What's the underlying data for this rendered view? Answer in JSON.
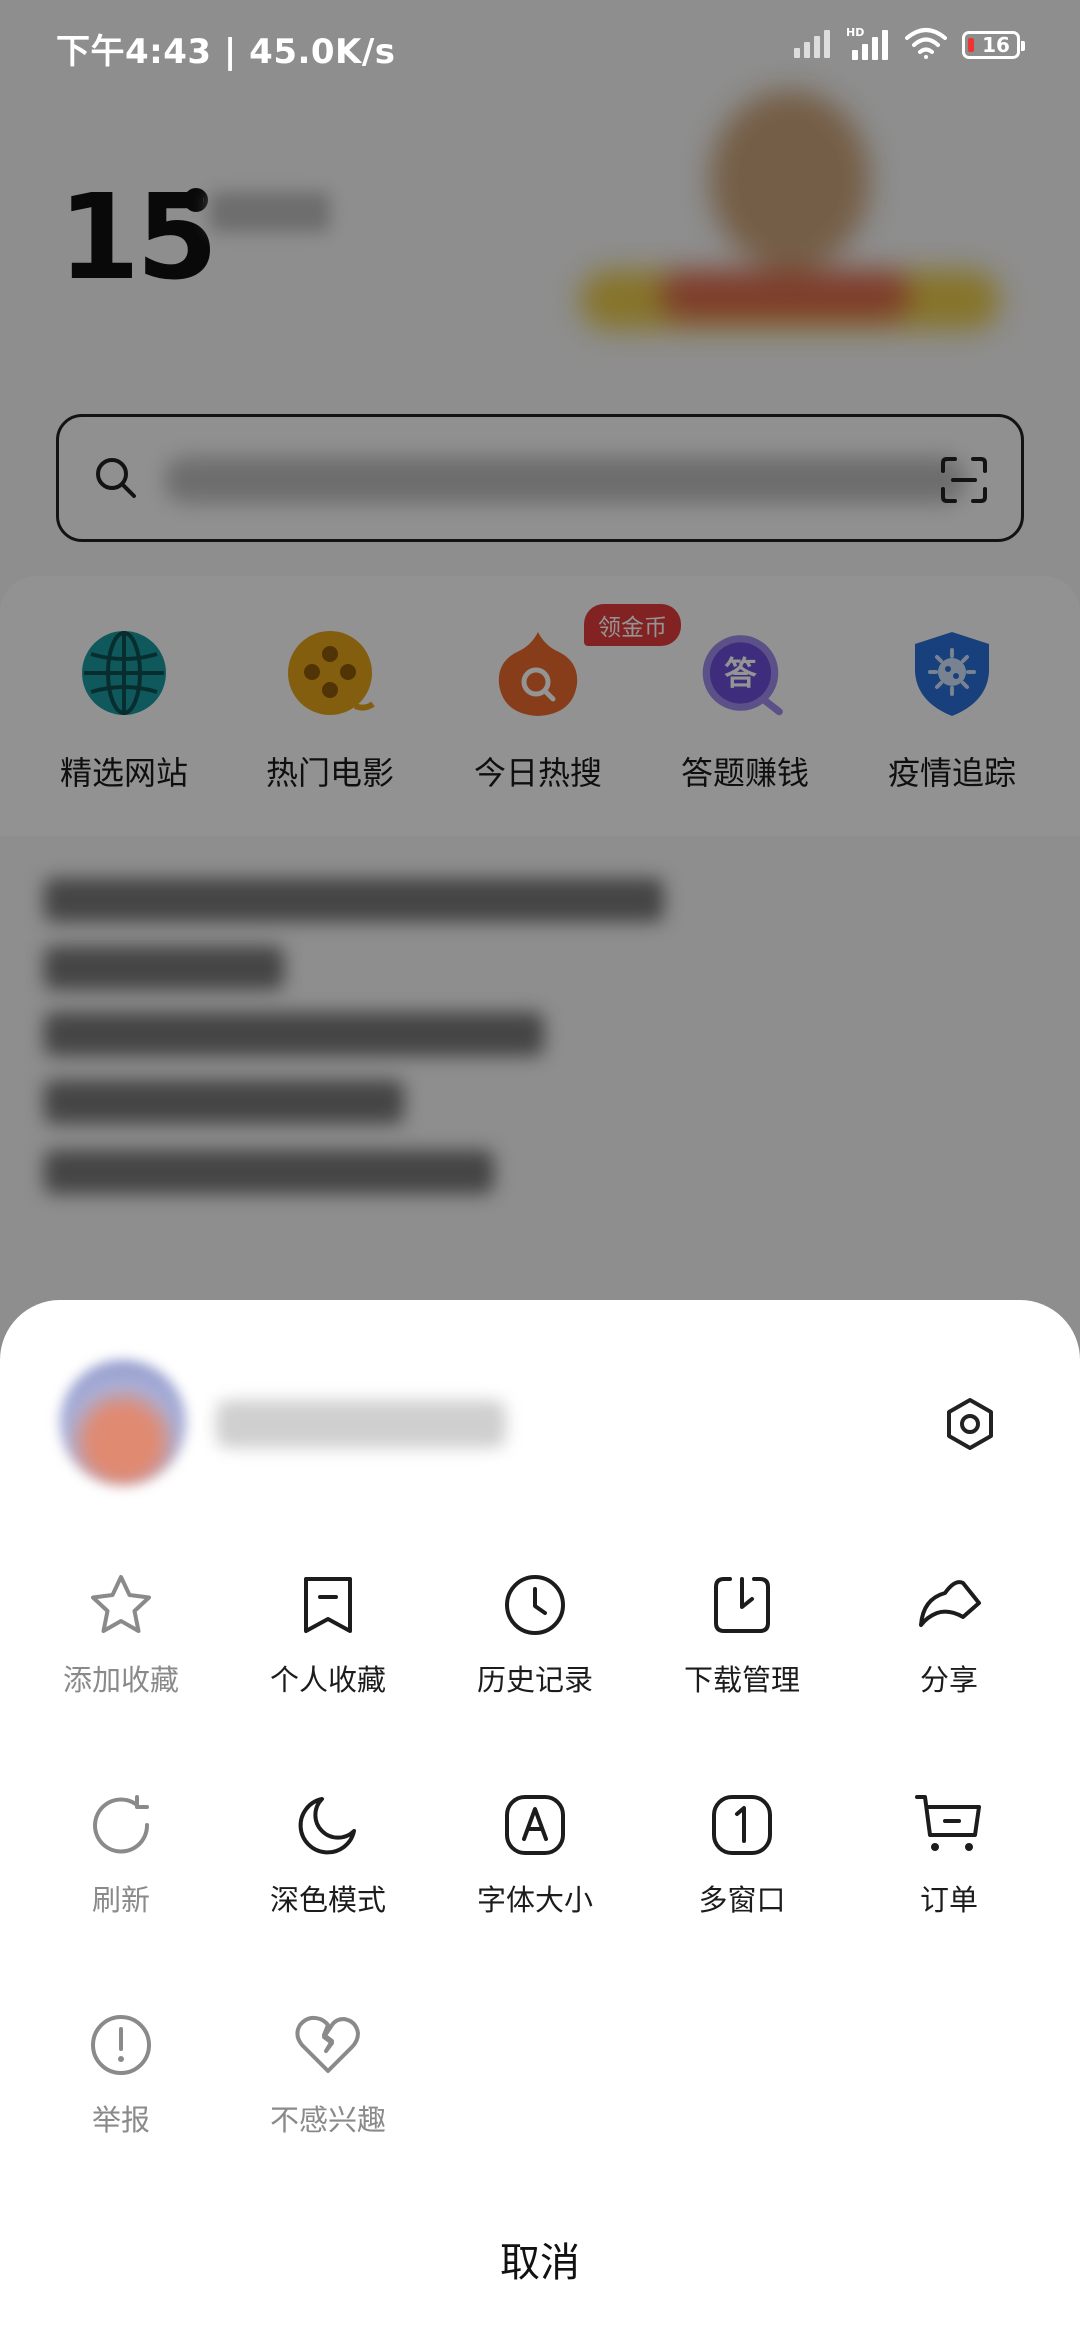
{
  "status_bar": {
    "time_speed": "下午4:43 | 45.0K/s",
    "battery": "16"
  },
  "weather": {
    "temperature": "15"
  },
  "quick_links": [
    {
      "label": "精选网站",
      "icon": "globe-icon",
      "color": "#1a9aa0"
    },
    {
      "label": "热门电影",
      "icon": "film-reel-icon",
      "color": "#e3a21a"
    },
    {
      "label": "今日热搜",
      "icon": "hot-search-icon",
      "color": "#e8692c",
      "badge": "领金币"
    },
    {
      "label": "答题赚钱",
      "icon": "quiz-icon",
      "color": "#6b4fd8",
      "glyph": "答"
    },
    {
      "label": "疫情追踪",
      "icon": "virus-shield-icon",
      "color": "#2a6fd6"
    }
  ],
  "menu": {
    "rows": [
      [
        {
          "label": "添加收藏",
          "icon": "star-icon",
          "disabled": true
        },
        {
          "label": "个人收藏",
          "icon": "bookmark-icon",
          "disabled": false
        },
        {
          "label": "历史记录",
          "icon": "clock-icon",
          "disabled": false
        },
        {
          "label": "下载管理",
          "icon": "download-icon",
          "disabled": false
        },
        {
          "label": "分享",
          "icon": "share-icon",
          "disabled": false
        }
      ],
      [
        {
          "label": "刷新",
          "icon": "refresh-icon",
          "disabled": true
        },
        {
          "label": "深色模式",
          "icon": "moon-icon",
          "disabled": false
        },
        {
          "label": "字体大小",
          "icon": "font-size-icon",
          "disabled": false,
          "glyph": "A"
        },
        {
          "label": "多窗口",
          "icon": "multi-window-icon",
          "disabled": false,
          "glyph": "1"
        },
        {
          "label": "订单",
          "icon": "cart-icon",
          "disabled": false
        }
      ],
      [
        {
          "label": "举报",
          "icon": "report-icon",
          "disabled": true
        },
        {
          "label": "不感兴趣",
          "icon": "broken-heart-icon",
          "disabled": true
        }
      ]
    ],
    "cancel_label": "取消"
  }
}
